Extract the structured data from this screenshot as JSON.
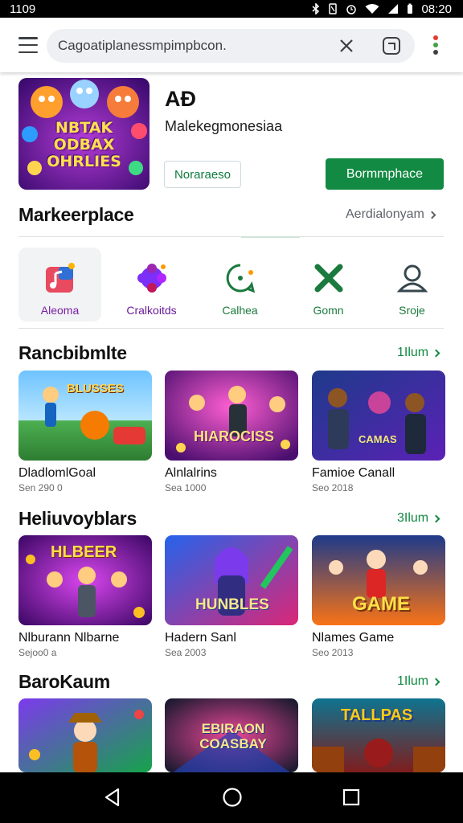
{
  "status_bar": {
    "time": "1109",
    "clock": "08:20"
  },
  "browser": {
    "url": "Cagoatiplanessmpimpbcon."
  },
  "hero": {
    "title": "AÐ",
    "subtitle": "Malekegmonesiaa",
    "outline_button": "Noraraeso",
    "primary_button": "Bormmphace",
    "image_text": [
      "NBTAK",
      "ODBAX",
      "OHRLIES"
    ]
  },
  "marketplace": {
    "title": "Markeerplace",
    "link": "Aerdialonyam"
  },
  "categories": [
    {
      "label": "Aleoma",
      "icon": "music-app-icon",
      "color": "#7b1fa2"
    },
    {
      "label": "Cralkoitds",
      "icon": "puzzle-icon",
      "color": "#6a1b9a"
    },
    {
      "label": "Calhea",
      "icon": "chat-bubble-icon",
      "color": "#1b7a3d"
    },
    {
      "label": "Gomn",
      "icon": "cross-icon",
      "color": "#1b7a3d"
    },
    {
      "label": "Sroje",
      "icon": "person-icon",
      "color": "#1b7a3d"
    }
  ],
  "sections": [
    {
      "title": "Rancbibmlte",
      "link": "1Ilum",
      "cards": [
        {
          "name": "DladlomlGoal",
          "meta": "Sen 290 0",
          "art": "BLUSSES"
        },
        {
          "name": "Alnlalrins",
          "meta": "Sea 1000",
          "art": "HIAROCISS"
        },
        {
          "name": "Famioe Canall",
          "meta": "Seo 2018",
          "art": "CAMAS"
        }
      ]
    },
    {
      "title": "Heliuvoyblars",
      "link": "3Ilum",
      "cards": [
        {
          "name": "Nlburann Nlbarne",
          "meta": "Sejoo0 a",
          "art": "HLBEER"
        },
        {
          "name": "Hadern Sanl",
          "meta": "Sea 2003",
          "art": "HUNBLES"
        },
        {
          "name": "Nlames Game",
          "meta": "Seo 2013",
          "art": "GAME"
        }
      ]
    },
    {
      "title": "BaroKaum",
      "link": "1Ilum",
      "cards": [
        {
          "name": "",
          "meta": "",
          "art": ""
        },
        {
          "name": "",
          "meta": "",
          "art": "EBIRAON COASBAY"
        },
        {
          "name": "",
          "meta": "",
          "art": "TALLPAS"
        }
      ]
    }
  ],
  "colors": {
    "accent": "#138a43",
    "text": "#202124",
    "muted": "#6b6b6b"
  }
}
